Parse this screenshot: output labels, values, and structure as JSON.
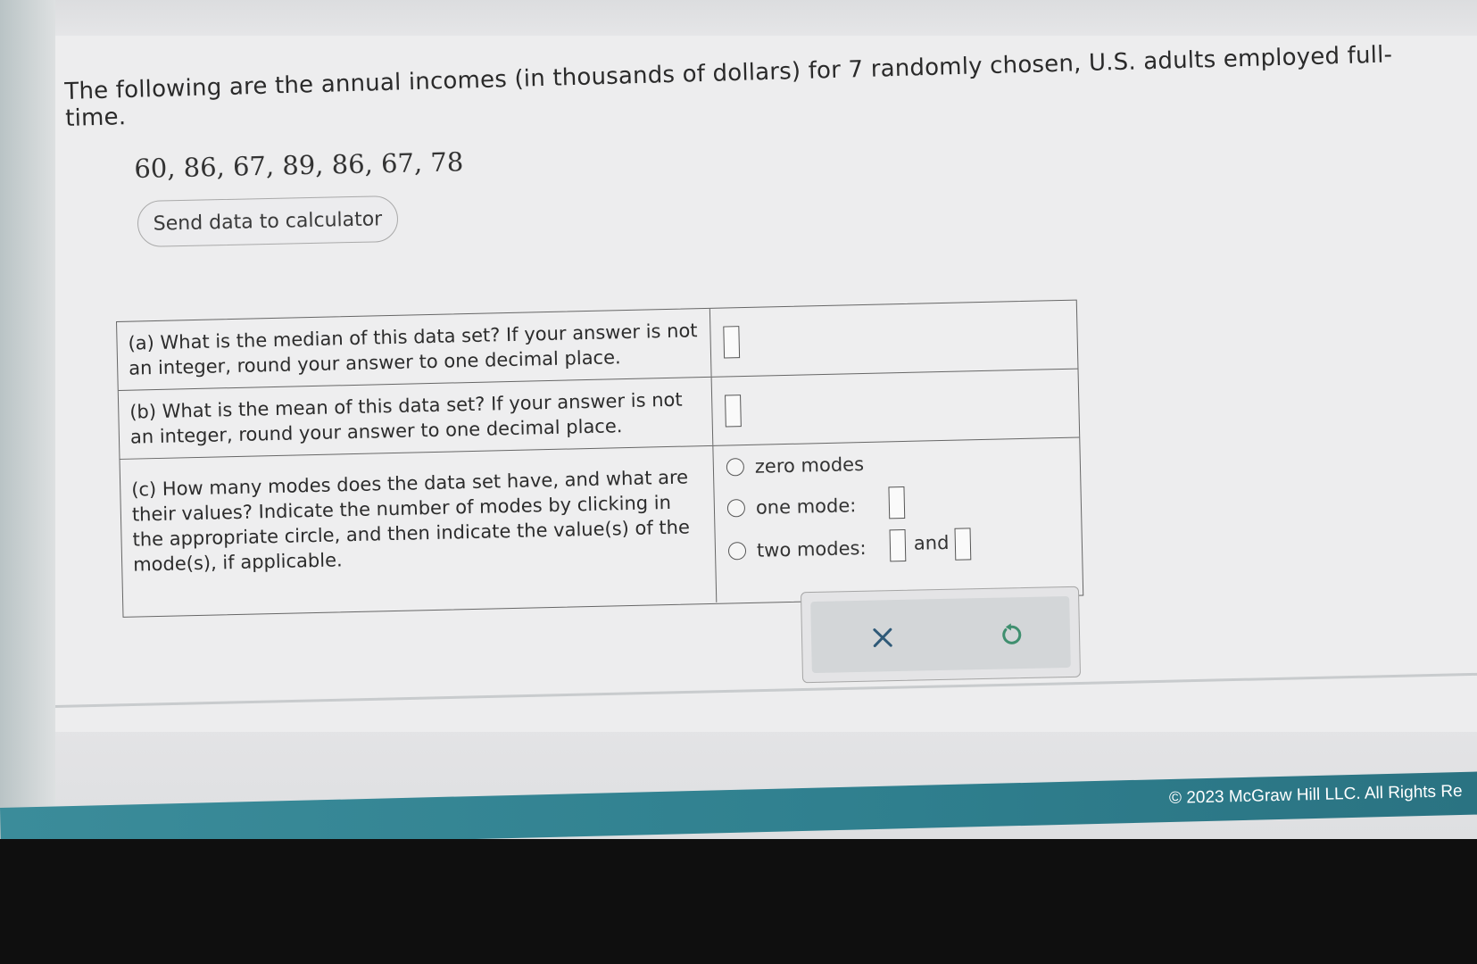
{
  "prompt": "The following are the annual incomes (in thousands of dollars) for 7 randomly chosen, U.S. adults employed full-time.",
  "data_values": "60, 86, 67, 89, 86, 67, 78",
  "send_button": "Send data to calculator",
  "questions": {
    "a": "(a) What is the median of this data set? If your answer is not an integer, round your answer to one decimal place.",
    "b": "(b) What is the mean of this data set? If your answer is not an integer, round your answer to one decimal place.",
    "c": "(c) How many modes does the data set have, and what are their values? Indicate the number of modes by clicking in the appropriate circle, and then indicate the value(s) of the mode(s), if applicable."
  },
  "mode_options": {
    "zero": "zero modes",
    "one": "one mode:",
    "two": "two modes:",
    "and": "and"
  },
  "actions": {
    "clear_icon": "close-icon",
    "undo_icon": "undo-icon"
  },
  "footer": {
    "copyright": "© 2023 McGraw Hill LLC. All Rights Re"
  },
  "colors": {
    "teal": "#2f7f8e",
    "undo_green": "#3f8f6f"
  }
}
